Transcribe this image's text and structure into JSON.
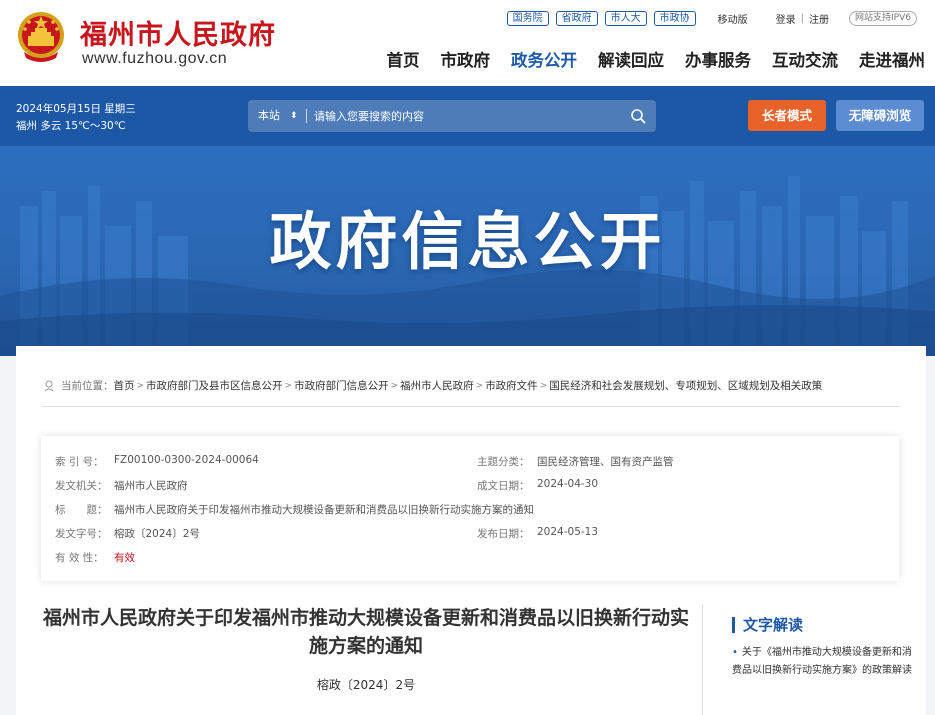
{
  "header": {
    "site_title": "福州市人民政府",
    "site_url": "www.fuzhou.gov.cn",
    "gov_links": [
      "国务院",
      "省政府",
      "市人大",
      "市政协"
    ],
    "mobile_label": "移动版",
    "login_label": "登录",
    "separator": "|",
    "register_label": "注册",
    "ipv6_label": "网站支持IPV6"
  },
  "nav": {
    "items": [
      "首页",
      "市政府",
      "政务公开",
      "解读回应",
      "办事服务",
      "互动交流",
      "走进福州"
    ],
    "active_index": 2
  },
  "infobar": {
    "date": "2024年05月15日 星期三",
    "weather": "福州 多云 15℃～30℃",
    "search_scope": "本站",
    "search_placeholder": "请输入您要搜索的内容",
    "elder_mode_label": "长者模式",
    "accessibility_label": "无障碍浏览"
  },
  "banner": {
    "title": "政府信息公开"
  },
  "breadcrumb": {
    "label": "当前位置：",
    "items": [
      "首页",
      "市政府部门及县市区信息公开",
      "市政府部门信息公开",
      "福州市人民政府",
      "市政府文件",
      "国民经济和社会发展规划、专项规划、区域规划及相关政策"
    ]
  },
  "meta": {
    "index_no_label": "索 引 号：",
    "index_no": "FZ00100-0300-2024-00064",
    "subject_label": "主题分类：",
    "subject": "国民经济管理、国有资产监管",
    "issuer_label": "发文机关：",
    "issuer": "福州市人民政府",
    "created_label": "成文日期：",
    "created": "2024-04-30",
    "title_label": "标　　题：",
    "title": "福州市人民政府关于印发福州市推动大规模设备更新和消费品以旧换新行动实施方案的通知",
    "doc_no_label": "发文字号：",
    "doc_no": "榕政〔2024〕2号",
    "published_label": "发布日期：",
    "published": "2024-05-13",
    "validity_label": "有 效 性：",
    "validity": "有效"
  },
  "document": {
    "title": "福州市人民政府关于印发福州市推动大规模设备更新和消费品以旧换新行动实施方案的通知",
    "number": "榕政〔2024〕2号"
  },
  "sidebar": {
    "title": "文字解读",
    "bullet": "•",
    "item": "关于《福州市推动大规模设备更新和消费品以旧换新行动实施方案》的政策解读"
  },
  "colors": {
    "brand_red": "#c8161d",
    "brand_blue": "#1d58a6",
    "elder_orange": "#e8622a",
    "access_blue": "#5b8bd1"
  },
  "icons": [
    "national-emblem-icon",
    "search-icon",
    "location-icon"
  ]
}
